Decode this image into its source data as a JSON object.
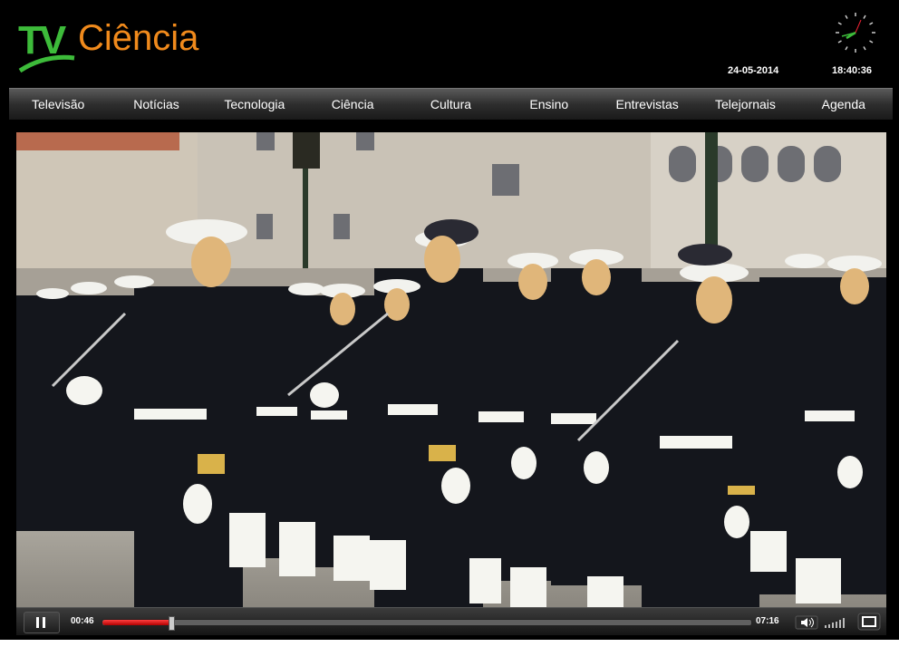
{
  "header": {
    "logo_tv": "TV",
    "logo_ciencia": "Ciência",
    "date": "24-05-2014",
    "time": "18:40:36"
  },
  "nav": {
    "items": [
      {
        "label": "Televisão"
      },
      {
        "label": "Notícias"
      },
      {
        "label": "Tecnologia"
      },
      {
        "label": "Ciência"
      },
      {
        "label": "Cultura"
      },
      {
        "label": "Ensino"
      },
      {
        "label": "Entrevistas"
      },
      {
        "label": "Telejornais"
      },
      {
        "label": "Agenda"
      }
    ]
  },
  "player": {
    "current_time": "00:46",
    "duration": "07:16",
    "progress": 0.106,
    "play_icon": "pause-icon",
    "volume_icon": "speaker-icon",
    "fullscreen_icon": "fullscreen-icon"
  },
  "colors": {
    "logo_green": "#3dbb3a",
    "logo_orange": "#f08a1c",
    "seek_fill": "#d01010"
  }
}
